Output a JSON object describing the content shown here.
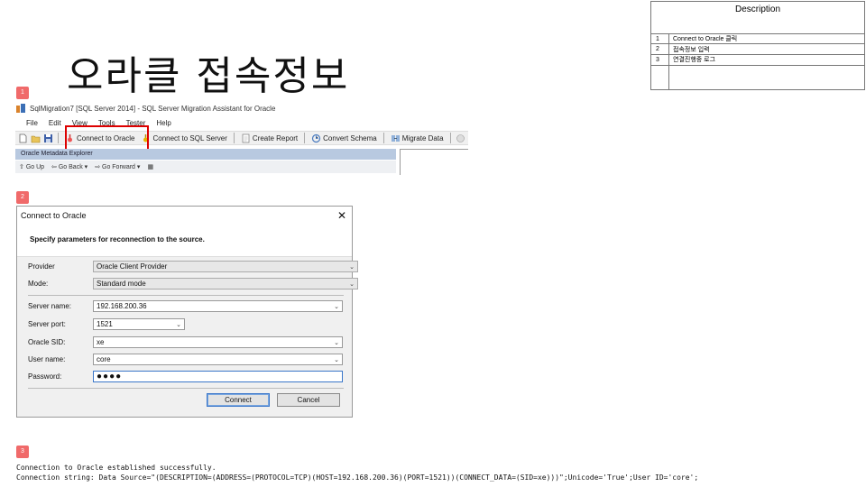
{
  "slide": {
    "title": "오라클 접속정보"
  },
  "badges": [
    "1",
    "2",
    "3"
  ],
  "description": {
    "header": "Description",
    "rows": [
      {
        "num": "1",
        "text": "Connect to Oracle 클릭"
      },
      {
        "num": "2",
        "text": "접속정보 입력"
      },
      {
        "num": "3",
        "text": "연결진행중 로그"
      }
    ]
  },
  "app": {
    "title": "SqlMigration7 [SQL Server 2014] - SQL Server Migration Assistant for Oracle",
    "menu": [
      "File",
      "Edit",
      "View",
      "Tools",
      "Tester",
      "Help"
    ],
    "toolbar": {
      "connect_oracle": "Connect to Oracle",
      "connect_sql": "Connect to SQL Server",
      "create_report": "Create Report",
      "convert_schema": "Convert Schema",
      "migrate_data": "Migrate Data"
    },
    "panel_title": "Oracle Metadata Explorer",
    "nav": {
      "go_up": "Go Up",
      "go_back": "Go Back",
      "go_forward": "Go Forward"
    },
    "colors": {
      "highlight": "#dd0000",
      "panel_header": "#b8c9e0"
    }
  },
  "dialog": {
    "title": "Connect to Oracle",
    "heading": "Specify parameters for reconnection to the source.",
    "fields": {
      "provider_label": "Provider",
      "provider_value": "Oracle Client Provider",
      "mode_label": "Mode:",
      "mode_value": "Standard mode",
      "server_name_label": "Server name:",
      "server_name_value": "192.168.200.36",
      "server_port_label": "Server port:",
      "server_port_value": "1521",
      "sid_label": "Oracle SID:",
      "sid_value": "xe",
      "user_label": "User name:",
      "user_value": "core",
      "password_label": "Password:",
      "password_value": "●●●●"
    },
    "buttons": {
      "connect": "Connect",
      "cancel": "Cancel"
    }
  },
  "log": {
    "line1": "Connection to Oracle established successfully.",
    "line2": "Connection string: Data Source=\"(DESCRIPTION=(ADDRESS=(PROTOCOL=TCP)(HOST=192.168.200.36)(PORT=1521))(CONNECT_DATA=(SID=xe)))\";Unicode='True';User ID='core';"
  }
}
